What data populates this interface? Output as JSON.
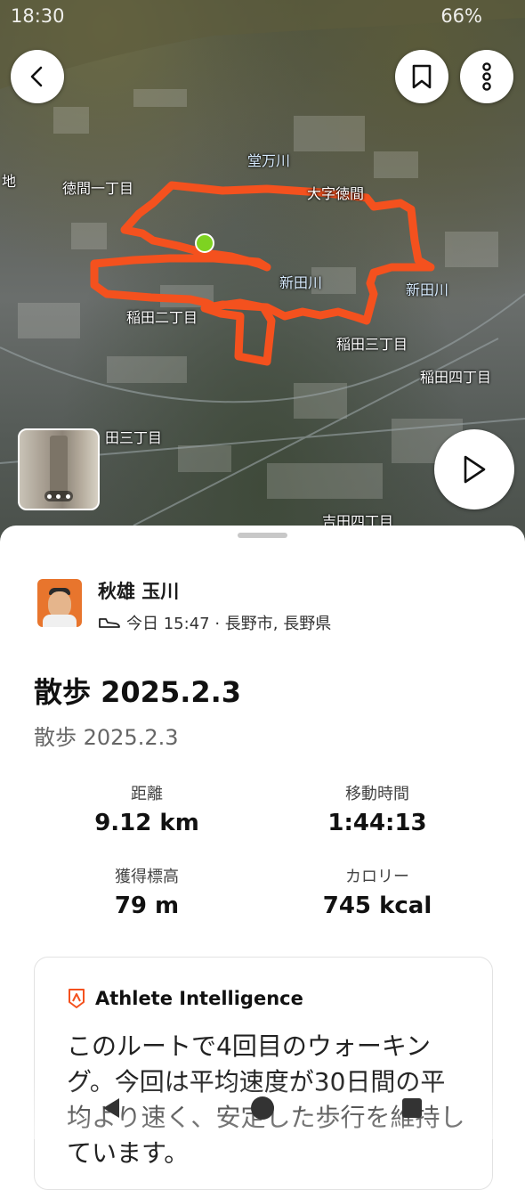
{
  "status_bar": {
    "time": "18:30",
    "battery": "66%"
  },
  "map": {
    "labels": {
      "tokuma1": "徳間一丁目",
      "oaza": "大字徳間",
      "doman": "堂万川",
      "chi": "地",
      "shinden1": "新田川",
      "shinden2": "新田川",
      "inada2": "稲田二丁目",
      "inada3a": "稲田三丁目",
      "inada4": "稲田四丁目",
      "inada3b": "田三丁目",
      "yoshida4": "吉田四丁目"
    },
    "route_color": "#f4511e"
  },
  "header_buttons": {
    "back_icon": "chevron-left",
    "bookmark_icon": "bookmark",
    "more_icon": "vertical-dots",
    "play_icon": "play"
  },
  "activity": {
    "athlete_name": "秋雄 玉川",
    "meta_text": "今日 15:47 · 長野市, 長野県",
    "title": "散歩 2025.2.3",
    "description": "散歩 2025.2.3"
  },
  "stats": [
    {
      "label": "距離",
      "value": "9.12 km"
    },
    {
      "label": "移動時間",
      "value": "1:44:13"
    },
    {
      "label": "獲得標高",
      "value": "79 m"
    },
    {
      "label": "カロリー",
      "value": "745 kcal"
    }
  ],
  "insight": {
    "heading": "Athlete Intelligence",
    "body": "このルートで4回目のウォーキング。今回は平均速度が30日間の平均より速く、安定した歩行を維持しています。"
  },
  "colors": {
    "accent": "#f4511e"
  }
}
